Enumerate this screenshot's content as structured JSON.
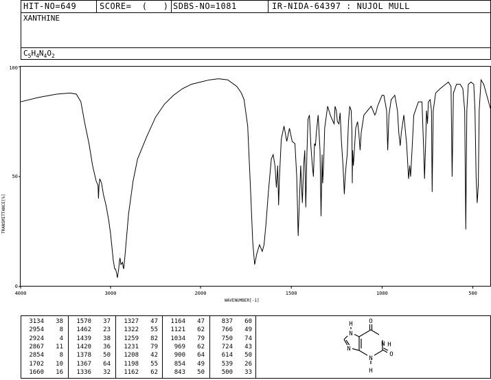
{
  "header": {
    "hit_no": "HIT-NO=649",
    "score": "SCORE=  (   )",
    "sdbs_no": "SDBS-NO=1081",
    "ir_nida": "IR-NIDA-64397 : NUJOL MULL"
  },
  "compound": {
    "name": "XANTHINE",
    "formula_parts": [
      "C",
      "5",
      "H",
      "4",
      "N",
      "4",
      "O",
      "2"
    ]
  },
  "chart_data": {
    "type": "line",
    "xlabel": "WAVENUMBER[-1]",
    "ylabel": "TRANSMITTANCE[%]",
    "xlim": [
      4000,
      400
    ],
    "ylim": [
      0,
      100
    ],
    "x_ticks": [
      "4000",
      "3000",
      "2000",
      "1500",
      "1000",
      "500"
    ],
    "y_ticks": [
      "100",
      "50",
      "0"
    ],
    "x_tick_values": [
      4000,
      3000,
      2000,
      1500,
      1000,
      500
    ],
    "y_tick_values": [
      100,
      50,
      0
    ],
    "series": [
      {
        "values": [
          [
            4000,
            84
          ],
          [
            3800,
            86
          ],
          [
            3600,
            87.5
          ],
          [
            3450,
            88
          ],
          [
            3380,
            87.5
          ],
          [
            3330,
            84
          ],
          [
            3290,
            75
          ],
          [
            3240,
            65
          ],
          [
            3200,
            55
          ],
          [
            3160,
            48
          ],
          [
            3140,
            46
          ],
          [
            3134,
            40
          ],
          [
            3128,
            46
          ],
          [
            3120,
            49
          ],
          [
            3100,
            47
          ],
          [
            3080,
            42
          ],
          [
            3050,
            37
          ],
          [
            3020,
            30
          ],
          [
            3000,
            24
          ],
          [
            2985,
            18
          ],
          [
            2970,
            12
          ],
          [
            2954,
            8
          ],
          [
            2945,
            8
          ],
          [
            2935,
            6.5
          ],
          [
            2924,
            4
          ],
          [
            2910,
            8
          ],
          [
            2900,
            12
          ],
          [
            2895,
            13
          ],
          [
            2885,
            10
          ],
          [
            2867,
            11
          ],
          [
            2860,
            9
          ],
          [
            2854,
            8
          ],
          [
            2840,
            14
          ],
          [
            2800,
            33
          ],
          [
            2750,
            48
          ],
          [
            2700,
            58
          ],
          [
            2600,
            68
          ],
          [
            2500,
            77
          ],
          [
            2400,
            83
          ],
          [
            2300,
            87
          ],
          [
            2200,
            90
          ],
          [
            2100,
            92
          ],
          [
            2000,
            93
          ],
          [
            1950,
            94
          ],
          [
            1900,
            94.5
          ],
          [
            1850,
            94
          ],
          [
            1800,
            91
          ],
          [
            1775,
            88
          ],
          [
            1760,
            85
          ],
          [
            1740,
            73
          ],
          [
            1725,
            45
          ],
          [
            1712,
            20
          ],
          [
            1702,
            10
          ],
          [
            1690,
            15
          ],
          [
            1675,
            19
          ],
          [
            1660,
            16
          ],
          [
            1650,
            19
          ],
          [
            1640,
            28
          ],
          [
            1625,
            44
          ],
          [
            1610,
            58
          ],
          [
            1600,
            60
          ],
          [
            1590,
            55
          ],
          [
            1582,
            45
          ],
          [
            1575,
            55
          ],
          [
            1570,
            37
          ],
          [
            1565,
            50
          ],
          [
            1555,
            67
          ],
          [
            1540,
            73
          ],
          [
            1525,
            66
          ],
          [
            1510,
            72
          ],
          [
            1495,
            66
          ],
          [
            1480,
            65
          ],
          [
            1470,
            50
          ],
          [
            1462,
            23
          ],
          [
            1455,
            40
          ],
          [
            1448,
            55
          ],
          [
            1439,
            38
          ],
          [
            1432,
            55
          ],
          [
            1426,
            62
          ],
          [
            1420,
            36
          ],
          [
            1414,
            60
          ],
          [
            1408,
            76
          ],
          [
            1400,
            78
          ],
          [
            1392,
            64
          ],
          [
            1385,
            56
          ],
          [
            1378,
            50
          ],
          [
            1372,
            65
          ],
          [
            1367,
            64
          ],
          [
            1362,
            70
          ],
          [
            1352,
            78
          ],
          [
            1342,
            62
          ],
          [
            1336,
            32
          ],
          [
            1330,
            60
          ],
          [
            1327,
            47
          ],
          [
            1322,
            55
          ],
          [
            1316,
            72
          ],
          [
            1300,
            82
          ],
          [
            1285,
            78
          ],
          [
            1270,
            75
          ],
          [
            1264,
            74
          ],
          [
            1259,
            82
          ],
          [
            1252,
            80
          ],
          [
            1246,
            75
          ],
          [
            1238,
            74
          ],
          [
            1231,
            79
          ],
          [
            1224,
            66
          ],
          [
            1215,
            55
          ],
          [
            1208,
            42
          ],
          [
            1203,
            50
          ],
          [
            1198,
            55
          ],
          [
            1192,
            60
          ],
          [
            1185,
            75
          ],
          [
            1178,
            82
          ],
          [
            1170,
            80
          ],
          [
            1166,
            70
          ],
          [
            1164,
            47
          ],
          [
            1162,
            62
          ],
          [
            1158,
            55
          ],
          [
            1145,
            72
          ],
          [
            1135,
            75
          ],
          [
            1128,
            70
          ],
          [
            1121,
            62
          ],
          [
            1115,
            70
          ],
          [
            1100,
            78
          ],
          [
            1080,
            80
          ],
          [
            1060,
            82
          ],
          [
            1050,
            80
          ],
          [
            1040,
            78
          ],
          [
            1034,
            79
          ],
          [
            1025,
            82
          ],
          [
            1010,
            85
          ],
          [
            1000,
            87
          ],
          [
            990,
            87
          ],
          [
            975,
            80
          ],
          [
            969,
            62
          ],
          [
            962,
            78
          ],
          [
            950,
            85
          ],
          [
            930,
            87
          ],
          [
            915,
            80
          ],
          [
            908,
            70
          ],
          [
            900,
            64
          ],
          [
            894,
            70
          ],
          [
            880,
            78
          ],
          [
            865,
            65
          ],
          [
            854,
            49
          ],
          [
            848,
            55
          ],
          [
            843,
            50
          ],
          [
            835,
            62
          ],
          [
            825,
            78
          ],
          [
            800,
            84
          ],
          [
            780,
            84
          ],
          [
            770,
            60
          ],
          [
            766,
            49
          ],
          [
            760,
            65
          ],
          [
            755,
            80
          ],
          [
            750,
            74
          ],
          [
            745,
            84
          ],
          [
            735,
            85
          ],
          [
            728,
            80
          ],
          [
            724,
            43
          ],
          [
            718,
            80
          ],
          [
            705,
            88
          ],
          [
            680,
            90
          ],
          [
            650,
            92
          ],
          [
            635,
            93
          ],
          [
            620,
            91
          ],
          [
            614,
            50
          ],
          [
            607,
            88
          ],
          [
            590,
            92
          ],
          [
            570,
            92
          ],
          [
            555,
            90
          ],
          [
            545,
            80
          ],
          [
            539,
            26
          ],
          [
            533,
            80
          ],
          [
            525,
            92
          ],
          [
            510,
            93
          ],
          [
            495,
            92
          ],
          [
            488,
            80
          ],
          [
            482,
            50
          ],
          [
            476,
            38
          ],
          [
            470,
            46
          ],
          [
            465,
            80
          ],
          [
            455,
            94
          ],
          [
            440,
            92
          ],
          [
            420,
            86
          ],
          [
            400,
            80
          ]
        ]
      }
    ]
  },
  "peak_table": {
    "columns": [
      [
        [
          "3134",
          "38"
        ],
        [
          "2954",
          "8"
        ],
        [
          "2924",
          "4"
        ],
        [
          "2867",
          "11"
        ],
        [
          "2854",
          "8"
        ],
        [
          "1702",
          "10"
        ],
        [
          "1660",
          "16"
        ]
      ],
      [
        [
          "1570",
          "37"
        ],
        [
          "1462",
          "23"
        ],
        [
          "1439",
          "38"
        ],
        [
          "1420",
          "36"
        ],
        [
          "1378",
          "50"
        ],
        [
          "1367",
          "64"
        ],
        [
          "1336",
          "32"
        ]
      ],
      [
        [
          "1327",
          "47"
        ],
        [
          "1322",
          "55"
        ],
        [
          "1259",
          "82"
        ],
        [
          "1231",
          "79"
        ],
        [
          "1208",
          "42"
        ],
        [
          "1198",
          "55"
        ],
        [
          "1162",
          "62"
        ]
      ],
      [
        [
          "1164",
          "47"
        ],
        [
          "1121",
          "62"
        ],
        [
          "1034",
          "79"
        ],
        [
          "969",
          "62"
        ],
        [
          "900",
          "64"
        ],
        [
          "854",
          "49"
        ],
        [
          "843",
          "50"
        ]
      ],
      [
        [
          "837",
          "60"
        ],
        [
          "766",
          "49"
        ],
        [
          "750",
          "74"
        ],
        [
          "724",
          "43"
        ],
        [
          "614",
          "50"
        ],
        [
          "539",
          "26"
        ],
        [
          "500",
          "33"
        ]
      ]
    ]
  },
  "structure": {
    "atom_labels": [
      "O",
      "O",
      "H",
      "N",
      "N",
      "N",
      "N",
      "H",
      "H"
    ]
  }
}
